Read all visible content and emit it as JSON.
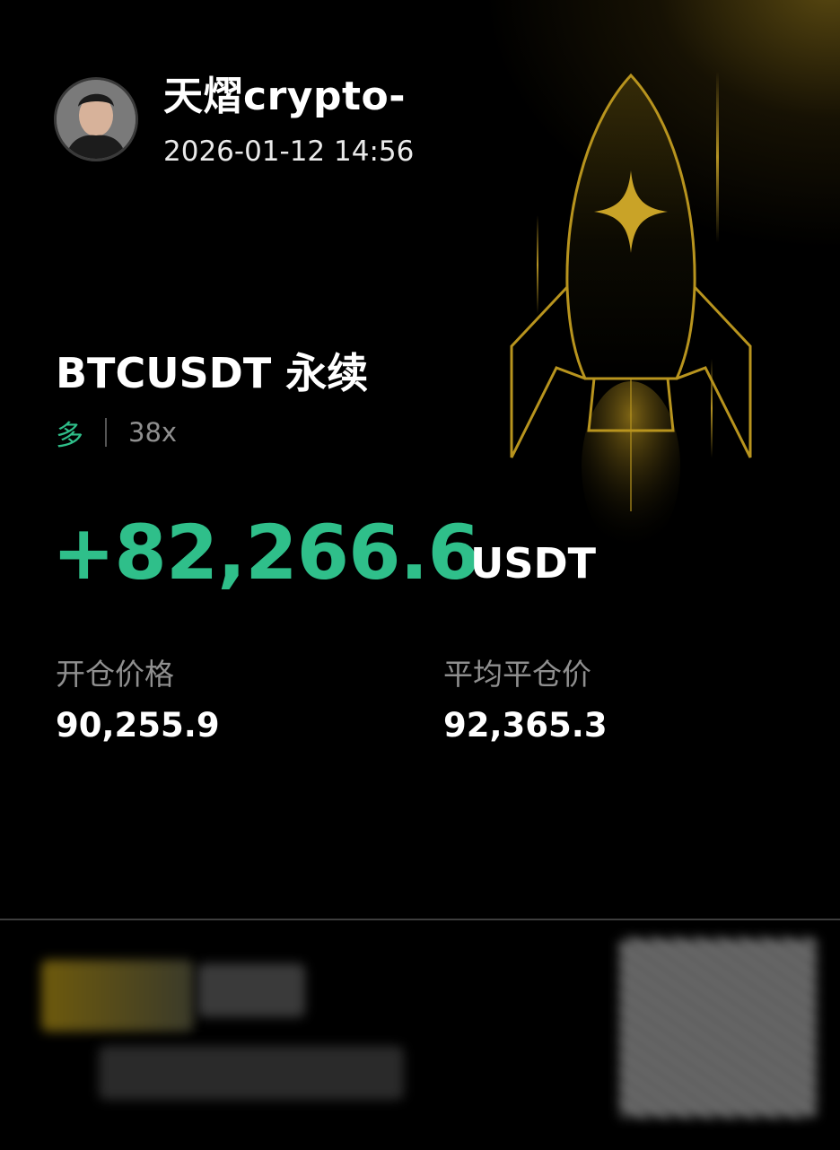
{
  "user": {
    "name": "天熠crypto-",
    "timestamp": "2026-01-12 14:56"
  },
  "position": {
    "contract": "BTCUSDT 永续",
    "side": "多",
    "leverage": "38x",
    "pnl": "+82,266.6",
    "pnl_unit": "USDT"
  },
  "stats": [
    {
      "label": "开仓价格",
      "value": "90,255.9"
    },
    {
      "label": "平均平仓价",
      "value": "92,365.3"
    }
  ],
  "colors": {
    "background": "#000000",
    "profit": "#2fbf8a",
    "muted": "#8f8f8f",
    "gold": "#b8941e"
  },
  "icons": {
    "hero_graphic": "rocket-icon",
    "avatar": "avatar"
  }
}
